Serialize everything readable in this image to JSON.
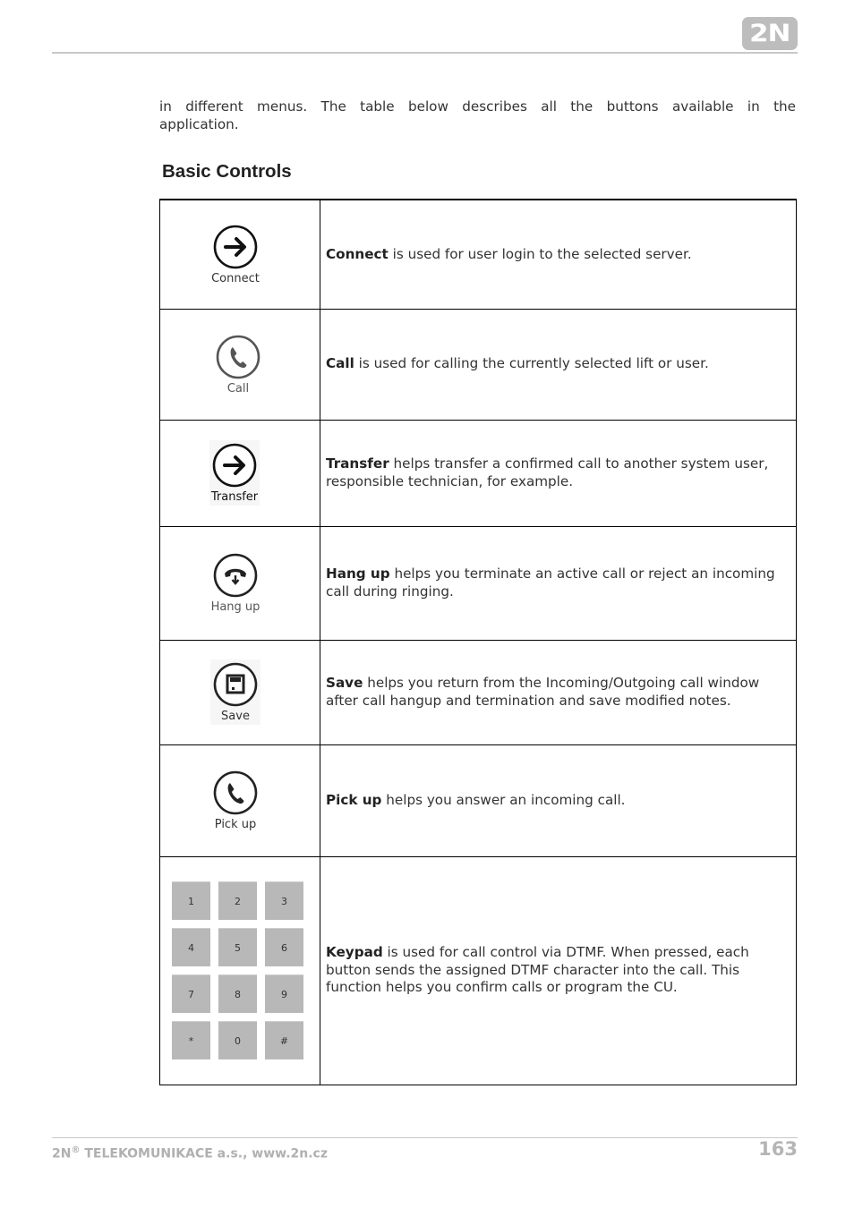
{
  "header": {
    "logo_text": "2N"
  },
  "intro": {
    "line1": "in different menus. The table below describes all the buttons available in the",
    "line2": "application."
  },
  "section_title": "Basic Controls",
  "controls": [
    {
      "icon": "arrow-right-circle-icon",
      "icon_label": "Connect",
      "name": "Connect",
      "description": " is used for user login to the selected server."
    },
    {
      "icon": "phone-circle-icon",
      "icon_label": "Call",
      "name": "Call",
      "description": " is used for calling the currently selected lift or user."
    },
    {
      "icon": "arrow-right-circle-icon",
      "icon_label": "Transfer",
      "name": "Transfer",
      "description": " helps transfer a confirmed call to another system user, responsible technician, for example."
    },
    {
      "icon": "hang-up-circle-icon",
      "icon_label": "Hang up",
      "name": "Hang up",
      "description": " helps you terminate an active call or reject an incoming call during ringing."
    },
    {
      "icon": "floppy-disk-circle-icon",
      "icon_label": "Save",
      "name": "Save",
      "description": " helps you return from the Incoming/Outgoing call window after call hangup and termination and save modified notes."
    },
    {
      "icon": "phone-circle-icon",
      "icon_label": "Pick up",
      "name": "Pick up",
      "description": " helps you answer an incoming call."
    },
    {
      "icon": "keypad-icon",
      "name": "Keypad",
      "description": " is used for call control via DTMF. When pressed, each button sends the assigned DTMF character into the call. This function helps you confirm calls or program the CU.",
      "keys": [
        "1",
        "2",
        "3",
        "4",
        "5",
        "6",
        "7",
        "8",
        "9",
        "*",
        "0",
        "#"
      ]
    }
  ],
  "footer": {
    "brand": "2N",
    "registered": "®",
    "company": " TELEKOMUNIKACE a.s., www.2n.cz",
    "page_number": "163"
  }
}
